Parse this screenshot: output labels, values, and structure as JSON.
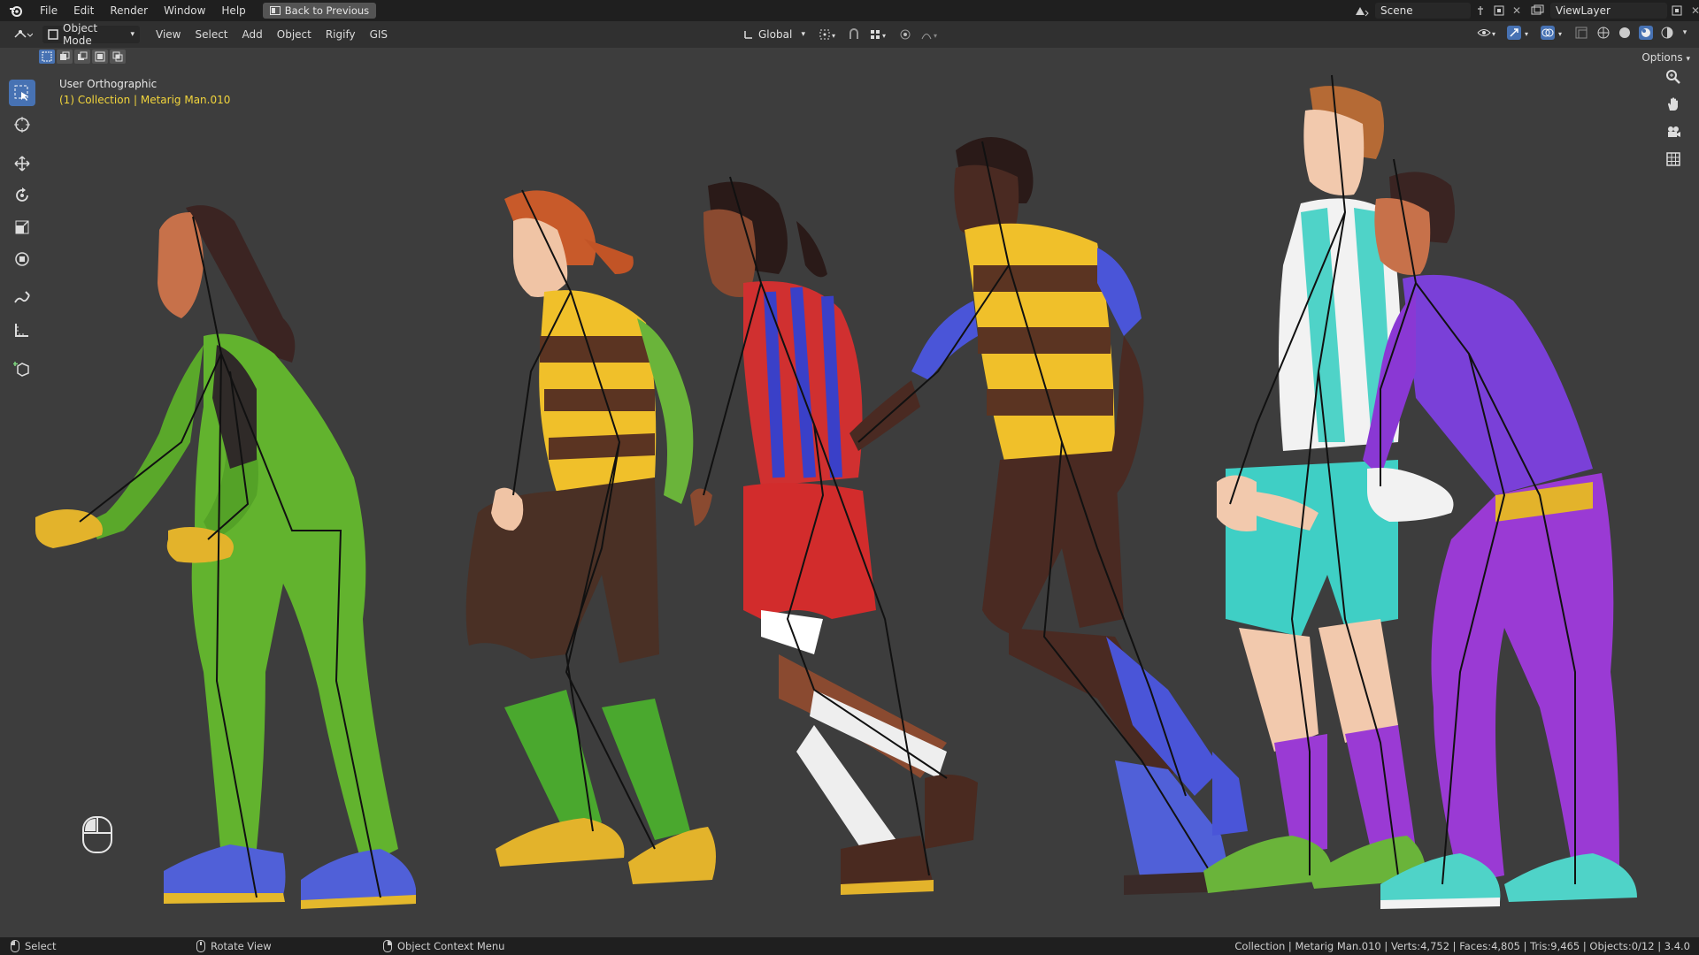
{
  "menubar": {
    "items": [
      "File",
      "Edit",
      "Render",
      "Window",
      "Help"
    ],
    "back_button": "Back to Previous",
    "scene": "Scene",
    "view_layer": "ViewLayer"
  },
  "header": {
    "mode": "Object Mode",
    "menus": [
      "View",
      "Select",
      "Add",
      "Object",
      "Rigify",
      "GIS"
    ],
    "transform_orientation": "Global",
    "options_label": "Options"
  },
  "viewport": {
    "view_name": "User Orthographic",
    "collection_info": "(1) Collection | Metarig Man.010"
  },
  "statusbar": {
    "left": [
      {
        "icon": "mouse-left-icon",
        "label": "Select"
      },
      {
        "icon": "mouse-middle-icon",
        "label": "Rotate View"
      },
      {
        "icon": "mouse-right-icon",
        "label": "Object Context Menu"
      }
    ],
    "stats": "Collection | Metarig Man.010 | Verts:4,752 | Faces:4,805 | Tris:9,465 | Objects:0/12 | 3.4.0"
  },
  "tools": [
    {
      "name": "select-box-tool",
      "active": true
    },
    {
      "name": "cursor-tool",
      "active": false
    },
    {
      "name": "move-tool",
      "active": false
    },
    {
      "name": "rotate-tool",
      "active": false
    },
    {
      "name": "scale-tool",
      "active": false
    },
    {
      "name": "transform-tool",
      "active": false
    },
    {
      "name": "annotate-tool",
      "active": false
    },
    {
      "name": "measure-tool",
      "active": false
    },
    {
      "name": "add-cube-tool",
      "active": false
    }
  ],
  "colors": {
    "accent": "#4772b3",
    "collection_text": "#f2d53c",
    "viewport_bg": "#3d3d3d"
  }
}
